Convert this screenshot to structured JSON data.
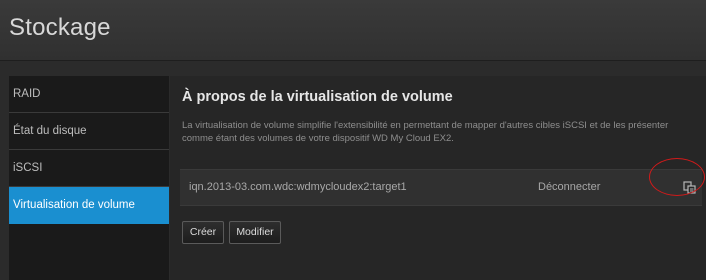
{
  "header": {
    "title": "Stockage"
  },
  "sidebar": {
    "items": [
      {
        "label": "RAID",
        "active": false
      },
      {
        "label": "État du disque",
        "active": false
      },
      {
        "label": "iSCSI",
        "active": false
      },
      {
        "label": "Virtualisation de volume",
        "active": true
      }
    ],
    "active_color": "#1a8fd0"
  },
  "main": {
    "section_title": "À propos de la virtualisation de volume",
    "description": "La virtualisation de volume simplifie l'extensibilité en permettant de mapper d'autres cibles iSCSI et de les présenter comme étant des volumes de votre dispositif WD My Cloud EX2.",
    "targets": [
      {
        "name": "iqn.2013-03.com.wdc:wdmycloudex2:target1",
        "action_label": "Déconnecter",
        "details_icon": "details-icon"
      }
    ],
    "buttons": {
      "create_label": "Créer",
      "modify_label": "Modifier"
    },
    "highlight_color": "#d11a1a"
  }
}
